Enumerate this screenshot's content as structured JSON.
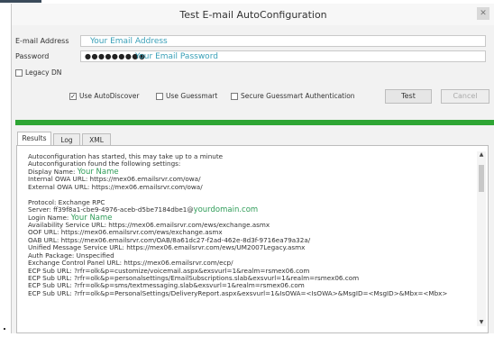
{
  "window": {
    "title": "Test E-mail AutoConfiguration",
    "close_glyph": "✕"
  },
  "form": {
    "email_label": "E-mail Address",
    "email_value": "Your Email Address",
    "password_label": "Password",
    "password_mask": "●●●●●●●●●",
    "password_value": "Your Email Password",
    "legacy_dn_label": "Legacy DN"
  },
  "options": [
    {
      "label": "Use AutoDiscover",
      "checked": true
    },
    {
      "label": "Use Guessmart",
      "checked": false
    },
    {
      "label": "Secure Guessmart Authentication",
      "checked": false
    }
  ],
  "buttons": {
    "test": "Test",
    "cancel": "Cancel"
  },
  "progress": {
    "fraction": 1.0,
    "color": "#2ea534"
  },
  "tabs": [
    {
      "label": "Results",
      "active": true
    },
    {
      "label": "Log",
      "active": false
    },
    {
      "label": "XML",
      "active": false
    }
  ],
  "results": {
    "lines": [
      {
        "text": "Autoconfiguration has started, this may take up to a minute"
      },
      {
        "text": "Autoconfiguration found the following settings:"
      },
      {
        "text": "Display Name: ",
        "highlight": "Your Name"
      },
      {
        "text": "Internal OWA URL: https://mex06.emailsrvr.com/owa/"
      },
      {
        "text": "External OWA URL: https://mex06.emailsrvr.com/owa/"
      },
      {
        "text": ""
      },
      {
        "text": "Protocol: Exchange RPC"
      },
      {
        "text": "Server: ff39f8a1-cbe9-4976-aceb-d5be7184dbe1@",
        "highlight": "yourdomain.com"
      },
      {
        "text": "Login Name: ",
        "highlight": "Your Name"
      },
      {
        "text": "Availability Service URL: https://mex06.emailsrvr.com/ews/exchange.asmx"
      },
      {
        "text": "OOF URL: https://mex06.emailsrvr.com/ews/exchange.asmx"
      },
      {
        "text": "OAB URL: https://mex06.emailsrvr.com/OAB/8a61dc27-f2ad-462e-8d3f-9716ea79a32a/"
      },
      {
        "text": "Unified Message Service URL: https://mex06.emailsrvr.com/ews/UM2007Legacy.asmx"
      },
      {
        "text": "Auth Package: Unspecified"
      },
      {
        "text": "Exchange Control Panel URL: https://mex06.emailsrvr.com/ecp/"
      },
      {
        "text": "ECP Sub URL: ?rfr=olk&p=customize/voicemail.aspx&exsvurl=1&realm=rsmex06.com"
      },
      {
        "text": "ECP Sub URL: ?rfr=olk&p=personalsettings/EmailSubscriptions.slab&exsvurl=1&realm=rsmex06.com"
      },
      {
        "text": "ECP Sub URL: ?rfr=olk&p=sms/textmessaging.slab&exsvurl=1&realm=rsmex06.com"
      },
      {
        "text": "ECP Sub URL: ?rfr=olk&p=PersonalSettings/DeliveryReport.aspx&exsvurl=1&IsOWA=<IsOWA>&MsgID=<MsgID>&Mbx=<Mbx>"
      }
    ]
  }
}
